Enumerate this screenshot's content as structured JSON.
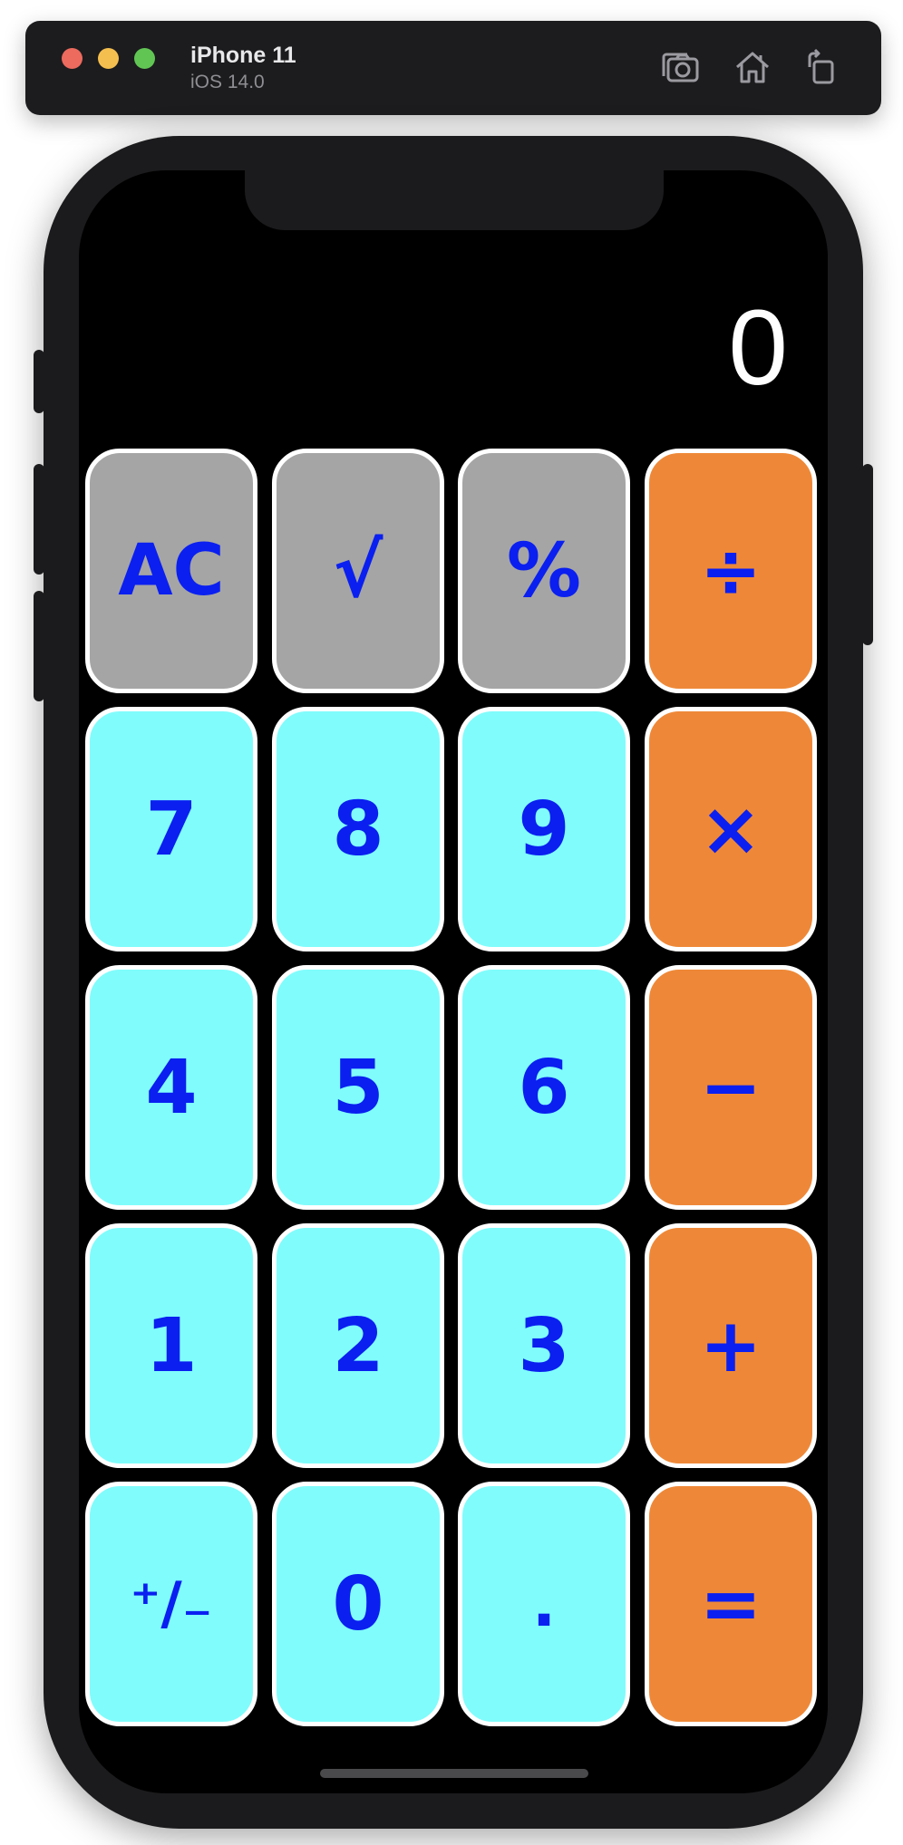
{
  "titlebar": {
    "device_name": "iPhone 11",
    "os_version": "iOS 14.0"
  },
  "calculator": {
    "display_value": "0",
    "keys": [
      {
        "label": "AC",
        "name": "clear-button",
        "style": "gray"
      },
      {
        "label": "√",
        "name": "square-root-button",
        "style": "gray"
      },
      {
        "label": "%",
        "name": "percent-button",
        "style": "gray"
      },
      {
        "label": "÷",
        "name": "divide-button",
        "style": "orange"
      },
      {
        "label": "7",
        "name": "digit-7-button",
        "style": "cyan"
      },
      {
        "label": "8",
        "name": "digit-8-button",
        "style": "cyan"
      },
      {
        "label": "9",
        "name": "digit-9-button",
        "style": "cyan"
      },
      {
        "label": "×",
        "name": "multiply-button",
        "style": "orange"
      },
      {
        "label": "4",
        "name": "digit-4-button",
        "style": "cyan"
      },
      {
        "label": "5",
        "name": "digit-5-button",
        "style": "cyan"
      },
      {
        "label": "6",
        "name": "digit-6-button",
        "style": "cyan"
      },
      {
        "label": "−",
        "name": "subtract-button",
        "style": "orange"
      },
      {
        "label": "1",
        "name": "digit-1-button",
        "style": "cyan"
      },
      {
        "label": "2",
        "name": "digit-2-button",
        "style": "cyan"
      },
      {
        "label": "3",
        "name": "digit-3-button",
        "style": "cyan"
      },
      {
        "label": "+",
        "name": "add-button",
        "style": "orange"
      },
      {
        "label": "⁺∕₋",
        "name": "plus-minus-button",
        "style": "cyan"
      },
      {
        "label": "0",
        "name": "digit-0-button",
        "style": "cyan"
      },
      {
        "label": ".",
        "name": "decimal-button",
        "style": "cyan"
      },
      {
        "label": "=",
        "name": "equals-button",
        "style": "orange"
      }
    ]
  },
  "colors": {
    "key_text": "#0a1ff0",
    "gray_key": "#a5a5a5",
    "cyan_key": "#80fcfc",
    "orange_key": "#ee8838",
    "screen_background": "#000000"
  },
  "icons": {
    "screenshot": "camera-icon",
    "home": "home-icon",
    "rotate": "rotate-icon"
  }
}
